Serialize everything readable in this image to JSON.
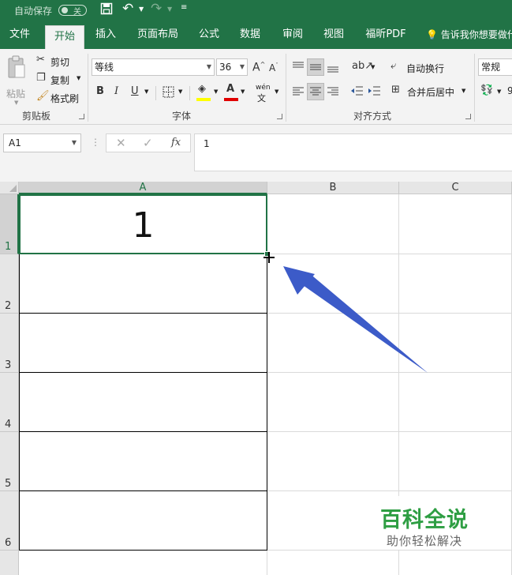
{
  "titlebar": {
    "autosave_label": "自动保存",
    "autosave_state": "关"
  },
  "tabs": [
    {
      "label": "文件"
    },
    {
      "label": "开始"
    },
    {
      "label": "插入"
    },
    {
      "label": "页面布局"
    },
    {
      "label": "公式"
    },
    {
      "label": "数据"
    },
    {
      "label": "审阅"
    },
    {
      "label": "视图"
    },
    {
      "label": "福昕PDF"
    }
  ],
  "tell_me": "告诉我你想要做什",
  "ribbon": {
    "clipboard": {
      "paste_label": "粘贴",
      "cut_label": "剪切",
      "copy_label": "复制",
      "format_painter_label": "格式刷",
      "group_label": "剪贴板"
    },
    "font": {
      "font_name": "等线",
      "font_size": "36",
      "bold": "B",
      "italic": "I",
      "underline": "U",
      "phonetic": "wén",
      "group_label": "字体"
    },
    "alignment": {
      "wrap_text": "自动换行",
      "merge_center": "合并后居中",
      "group_label": "对齐方式"
    },
    "number": {
      "format": "常规"
    }
  },
  "formula_bar": {
    "name_box": "A1",
    "fx": "fx",
    "content": "1"
  },
  "grid": {
    "columns": [
      "A",
      "B",
      "C"
    ],
    "rows": [
      "1",
      "2",
      "3",
      "4",
      "5",
      "6"
    ],
    "active_cell_value": "1"
  },
  "watermark": {
    "title": "百科全说",
    "subtitle": "助你轻松解决"
  },
  "colors": {
    "excel_green": "#217346",
    "arrow": "#3c5bc8",
    "watermark_green": "#2e9e43"
  }
}
